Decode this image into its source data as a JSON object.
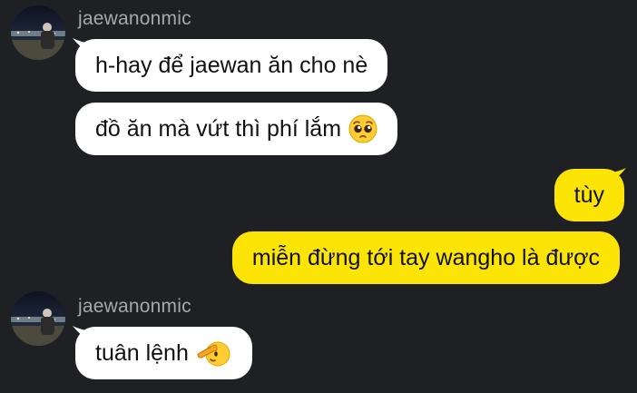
{
  "messages": [
    {
      "group": "incoming-1",
      "sender": "jaewanonmic",
      "bubbles": [
        {
          "text": "h-hay để jaewan ăn cho nè"
        },
        {
          "text": "đồ ăn mà vứt thì phí lắm",
          "emoji": "pleading-face-emoji"
        }
      ]
    },
    {
      "group": "outgoing",
      "bubbles": [
        {
          "text": "tùy"
        },
        {
          "text": "miễn đừng tới tay wangho là được"
        }
      ]
    },
    {
      "group": "incoming-2",
      "sender": "jaewanonmic",
      "bubbles": [
        {
          "text": "tuân lệnh",
          "emoji": "saluting-face-emoji"
        }
      ]
    }
  ],
  "colors": {
    "background": "#1f2023",
    "incoming_bubble": "#ffffff",
    "outgoing_bubble": "#fde407",
    "sender_name": "#a7a8ab",
    "bubble_text": "#111111"
  }
}
